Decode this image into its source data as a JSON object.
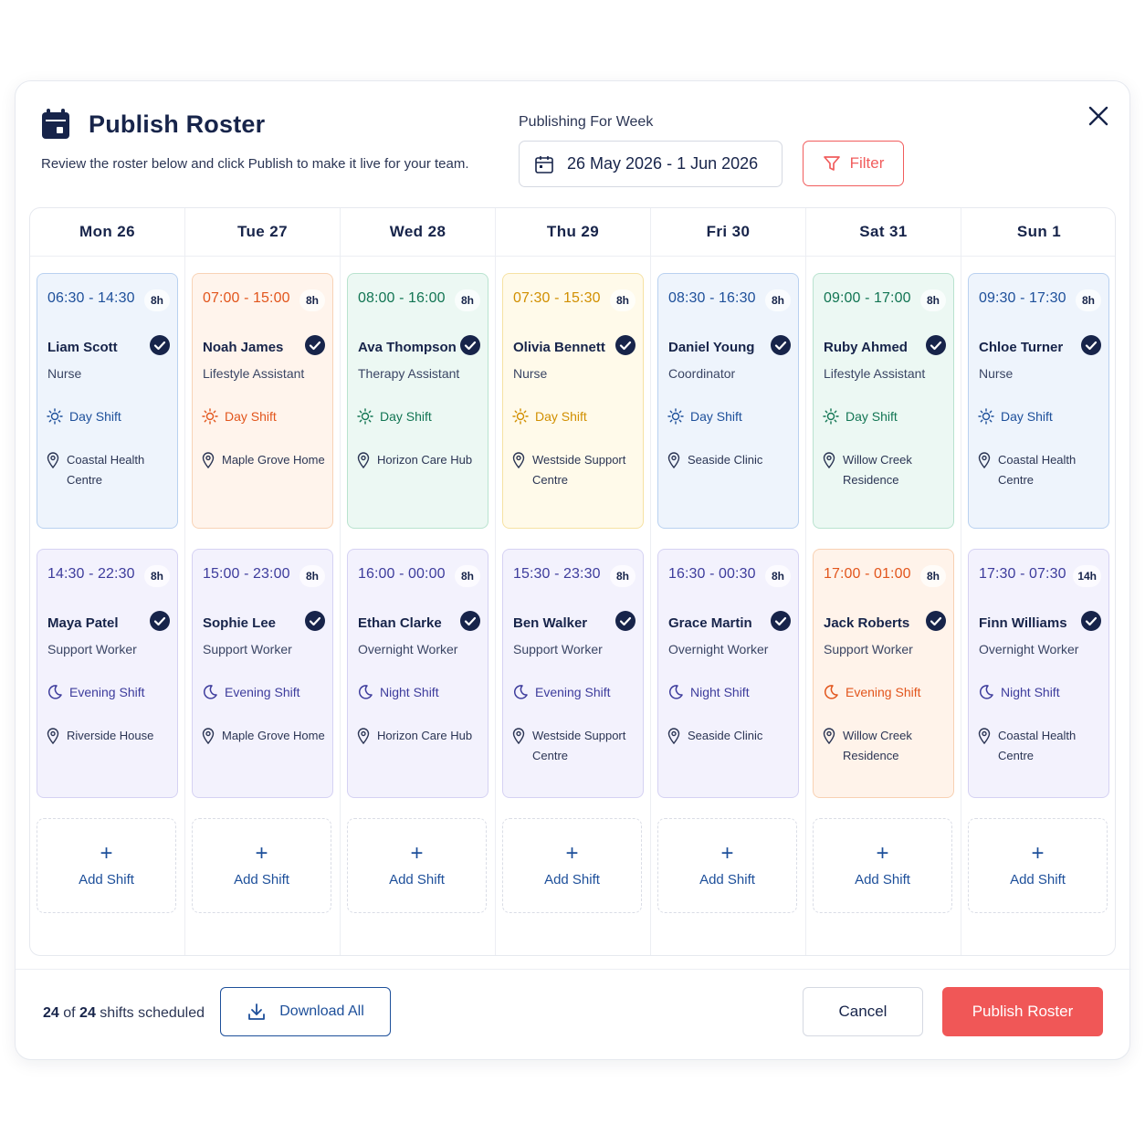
{
  "header": {
    "title": "Publish Roster",
    "subtitle": "Review the roster below and click Publish to make it live for your team.",
    "week_label": "Publishing For Week",
    "week_range": "26 May 2026  -  1 Jun 2026",
    "filter_label": "Filter"
  },
  "days": [
    "Mon  26",
    "Tue  27",
    "Wed  28",
    "Thu  29",
    "Fri  30",
    "Sat  31",
    "Sun  1"
  ],
  "shifts_top": [
    {
      "time": "06:30 - 14:30",
      "dur": "8h",
      "name": "Liam Scott",
      "role": "Nurse",
      "shift": "Day Shift",
      "location": "Coastal Health Centre",
      "color": "blue"
    },
    {
      "time": "07:00 - 15:00",
      "dur": "8h",
      "name": "Noah James",
      "role": "Lifestyle Assistant",
      "shift": "Day Shift",
      "location": "Maple Grove Home",
      "color": "orange"
    },
    {
      "time": "08:00 - 16:00",
      "dur": "8h",
      "name": "Ava Thompson",
      "role": "Therapy Assistant",
      "shift": "Day Shift",
      "location": "Horizon Care Hub",
      "color": "green"
    },
    {
      "time": "07:30 - 15:30",
      "dur": "8h",
      "name": "Olivia Bennett",
      "role": "Nurse",
      "shift": "Day Shift",
      "location": "Westside Support Centre",
      "color": "yellow"
    },
    {
      "time": "08:30 - 16:30",
      "dur": "8h",
      "name": "Daniel Young",
      "role": "Coordinator",
      "shift": "Day Shift",
      "location": "Seaside Clinic",
      "color": "blue"
    },
    {
      "time": "09:00 - 17:00",
      "dur": "8h",
      "name": "Ruby Ahmed",
      "role": "Lifestyle Assistant",
      "shift": "Day Shift",
      "location": "Willow Creek Residence",
      "color": "green"
    },
    {
      "time": "09:30 - 17:30",
      "dur": "8h",
      "name": "Chloe Turner",
      "role": "Nurse",
      "shift": "Day Shift",
      "location": "Coastal Health Centre",
      "color": "blue"
    }
  ],
  "shifts_bottom": [
    {
      "time": "14:30 - 22:30",
      "dur": "8h",
      "name": "Maya Patel",
      "role": "Support Worker",
      "shift": "Evening Shift",
      "location": "Riverside House",
      "color": "purple"
    },
    {
      "time": "15:00 - 23:00",
      "dur": "8h",
      "name": "Sophie Lee",
      "role": "Support Worker",
      "shift": "Evening Shift",
      "location": "Maple Grove Home",
      "color": "purple"
    },
    {
      "time": "16:00 - 00:00",
      "dur": "8h",
      "name": "Ethan Clarke",
      "role": "Overnight Worker",
      "shift": "Night Shift",
      "location": "Horizon Care Hub",
      "color": "purple"
    },
    {
      "time": "15:30 - 23:30",
      "dur": "8h",
      "name": "Ben Walker",
      "role": "Support Worker",
      "shift": "Evening Shift",
      "location": "Westside Support Centre",
      "color": "purple"
    },
    {
      "time": "16:30 - 00:30",
      "dur": "8h",
      "name": "Grace Martin",
      "role": "Overnight Worker",
      "shift": "Night Shift",
      "location": "Seaside Clinic",
      "color": "purple"
    },
    {
      "time": "17:00 - 01:00",
      "dur": "8h",
      "name": "Jack Roberts",
      "role": "Support Worker",
      "shift": "Evening Shift",
      "location": "Willow Creek Residence",
      "color": "peach"
    },
    {
      "time": "17:30 - 07:30",
      "dur": "14h",
      "name": "Finn Williams",
      "role": "Overnight Worker",
      "shift": "Night Shift",
      "location": "Coastal Health Centre",
      "color": "purple"
    }
  ],
  "add_shift_label": "Add Shift",
  "footer": {
    "scheduled": "24",
    "total": "24",
    "count_of": "of",
    "count_suffix": "shifts scheduled",
    "download_label": "Download All",
    "cancel_label": "Cancel",
    "publish_label": "Publish Roster"
  },
  "colors": {
    "accent": "#f05757",
    "primary": "#1d4f9a",
    "text": "#17244a"
  },
  "icons": {
    "title": "calendar-icon",
    "week": "calendar-icon",
    "filter": "funnel-icon",
    "close": "close-icon",
    "check": "check-circle-icon",
    "day_shift": "sun-icon",
    "evening_shift": "moon-icon",
    "location": "map-pin-icon",
    "download": "download-icon"
  }
}
